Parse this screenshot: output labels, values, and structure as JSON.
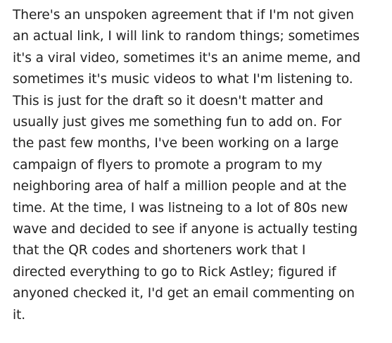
{
  "post": {
    "lines": [
      "There's an unspoken agreement that if I'm not given",
      "an actual link, I will link to random things; sometimes",
      "it's a viral video, sometimes it's an anime meme, and",
      "sometimes it's music videos to what I'm listening to.",
      "This is just for the draft so it doesn't matter and",
      "usually just gives me something fun to add on. For",
      "the past few months, I've been working on a large",
      "campaign of flyers to promote a program to my",
      "neighboring area of half a million people and at the",
      "time. At the time, I was listneing to a lot of 80s new",
      "wave and decided to see if anyone is actually testing",
      "that the QR codes and shorteners work that I",
      "directed everything to go to Rick Astley; figured if",
      "anyoned checked it, I'd get an email commenting on",
      "it."
    ]
  }
}
